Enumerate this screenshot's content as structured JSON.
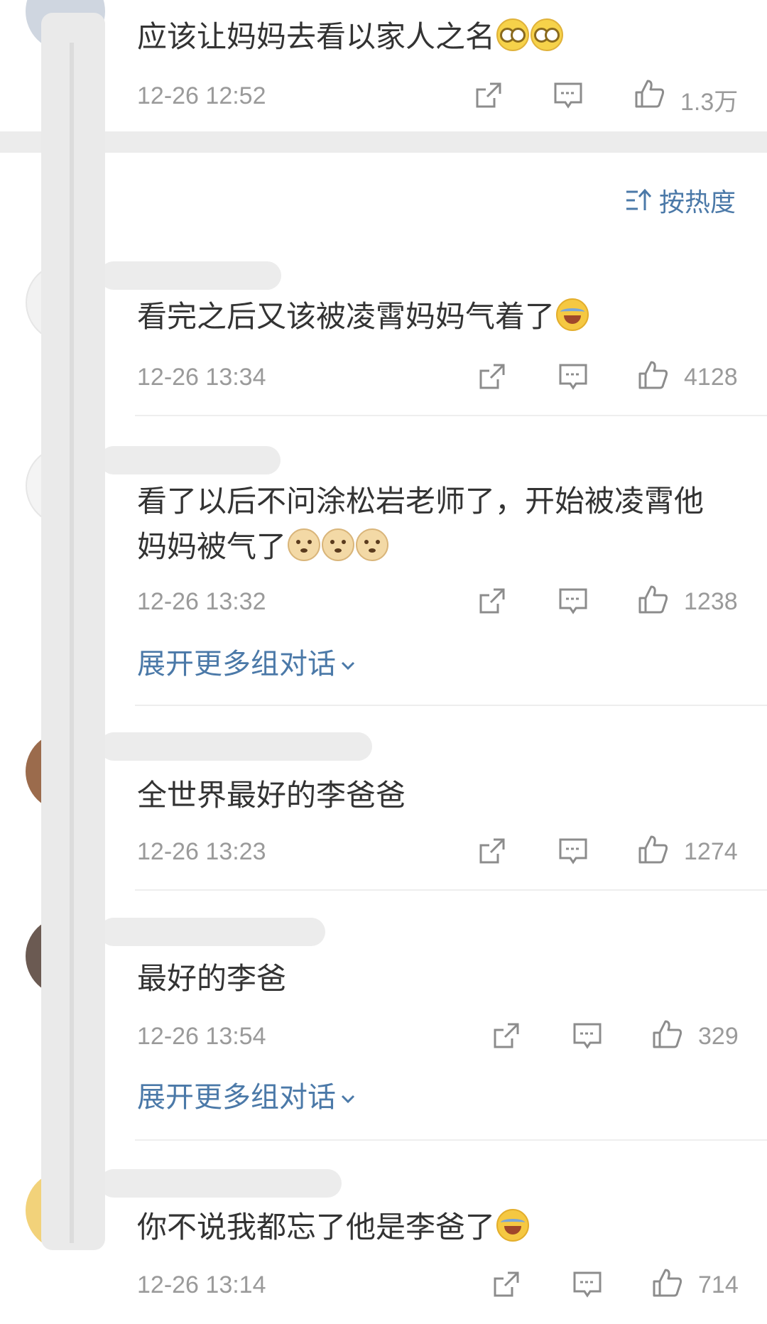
{
  "top_comment": {
    "text": "应该让妈妈去看以家人之名",
    "emojis": [
      "glasses-face",
      "glasses-face"
    ],
    "time": "12-26 12:52",
    "likes": "1.3万"
  },
  "sort": {
    "label": "按热度"
  },
  "comments": [
    {
      "text": "看完之后又该被凌霄妈妈气着了",
      "emojis": [
        "laugh-cry"
      ],
      "time": "12-26 13:34",
      "likes": "4128",
      "expand": ""
    },
    {
      "text": "看了以后不问涂松岩老师了，开始被凌霄他妈妈被气了",
      "emojis": [
        "doge",
        "doge",
        "doge"
      ],
      "time": "12-26 13:32",
      "likes": "1238",
      "expand": "展开更多组对话"
    },
    {
      "text": "全世界最好的李爸爸",
      "emojis": [],
      "time": "12-26 13:23",
      "likes": "1274",
      "expand": ""
    },
    {
      "text": "最好的李爸",
      "emojis": [],
      "time": "12-26 13:54",
      "likes": "329",
      "expand": "展开更多组对话"
    },
    {
      "text": "你不说我都忘了他是李爸了",
      "emojis": [
        "laugh-cry"
      ],
      "time": "12-26 13:14",
      "likes": "714",
      "expand": ""
    }
  ],
  "icons": {
    "repost": "repost-icon",
    "comment": "comment-icon",
    "like": "thumbs-up-icon",
    "sort": "sort-icon",
    "expand": "chevron-down-icon"
  },
  "colors": {
    "link": "#4b79a8",
    "meta": "#9a9a9a",
    "text": "#333333",
    "separator": "#eeeeee"
  }
}
